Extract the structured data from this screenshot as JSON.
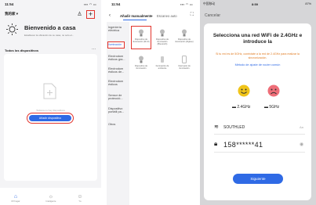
{
  "panel1": {
    "time": "11:54",
    "home_selector": "我的家 ▾",
    "welcome_title": "Bienvenido a casa",
    "welcome_subtitle": "Establecer la ubicación de su casa, no solo el...",
    "section_title": "Todos los dispositivos",
    "more_label": "···",
    "empty_text": "Todavía no hay dispositivos",
    "add_button": "Añadir dispositivo",
    "nav": [
      {
        "label": "Mi hogar",
        "icon": "home-icon"
      },
      {
        "label": "Inteligente",
        "icon": "sun-icon"
      },
      {
        "label": "Yo",
        "icon": "user-icon"
      }
    ]
  },
  "panel2": {
    "time": "11:54",
    "tab_manual": "Añadir manualmente",
    "tab_auto": "Escaneo auto",
    "categories": [
      "Ingeniería eléctrica",
      "Iluminación",
      "Electrodom ésticos gra...",
      "Electrodom ésticos de...",
      "Electrodom ésticos",
      "Sensor de protecció...",
      "Dispositivo portátil pa...",
      "Otros"
    ],
    "devices": [
      "Dispositivo de iluminación (Wi-Fi)",
      "Dispositivo de iluminación (Bluetooth)",
      "Dispositivo de iluminación (Zigbee)",
      "Dispositivo de iluminación",
      "Iluminación de ambiente",
      "Interruptor de iluminación"
    ]
  },
  "panel3": {
    "status_left": "中国移动",
    "time": "8:59",
    "status_right": "87%",
    "cancel_label": "Cancelar",
    "title": "Selecciona una red WiFi de 2.4GHz e introduce la",
    "subtitle": "Si tu red es de 5GHz, conéctate a la red de 2.4GHz para realizar la sincronización.",
    "router_link": "Método de ajuste de router común",
    "band_ok": "2.4GHz",
    "band_bad": "5GHz",
    "ssid": "SOUTHLED",
    "ssid_action": "Aa",
    "password": "158******41",
    "next_button": "Siguiente"
  },
  "colors": {
    "accent": "#2f6ae5",
    "highlight": "#e2332b",
    "good": "#f0c419",
    "bad": "#ee6e78"
  }
}
